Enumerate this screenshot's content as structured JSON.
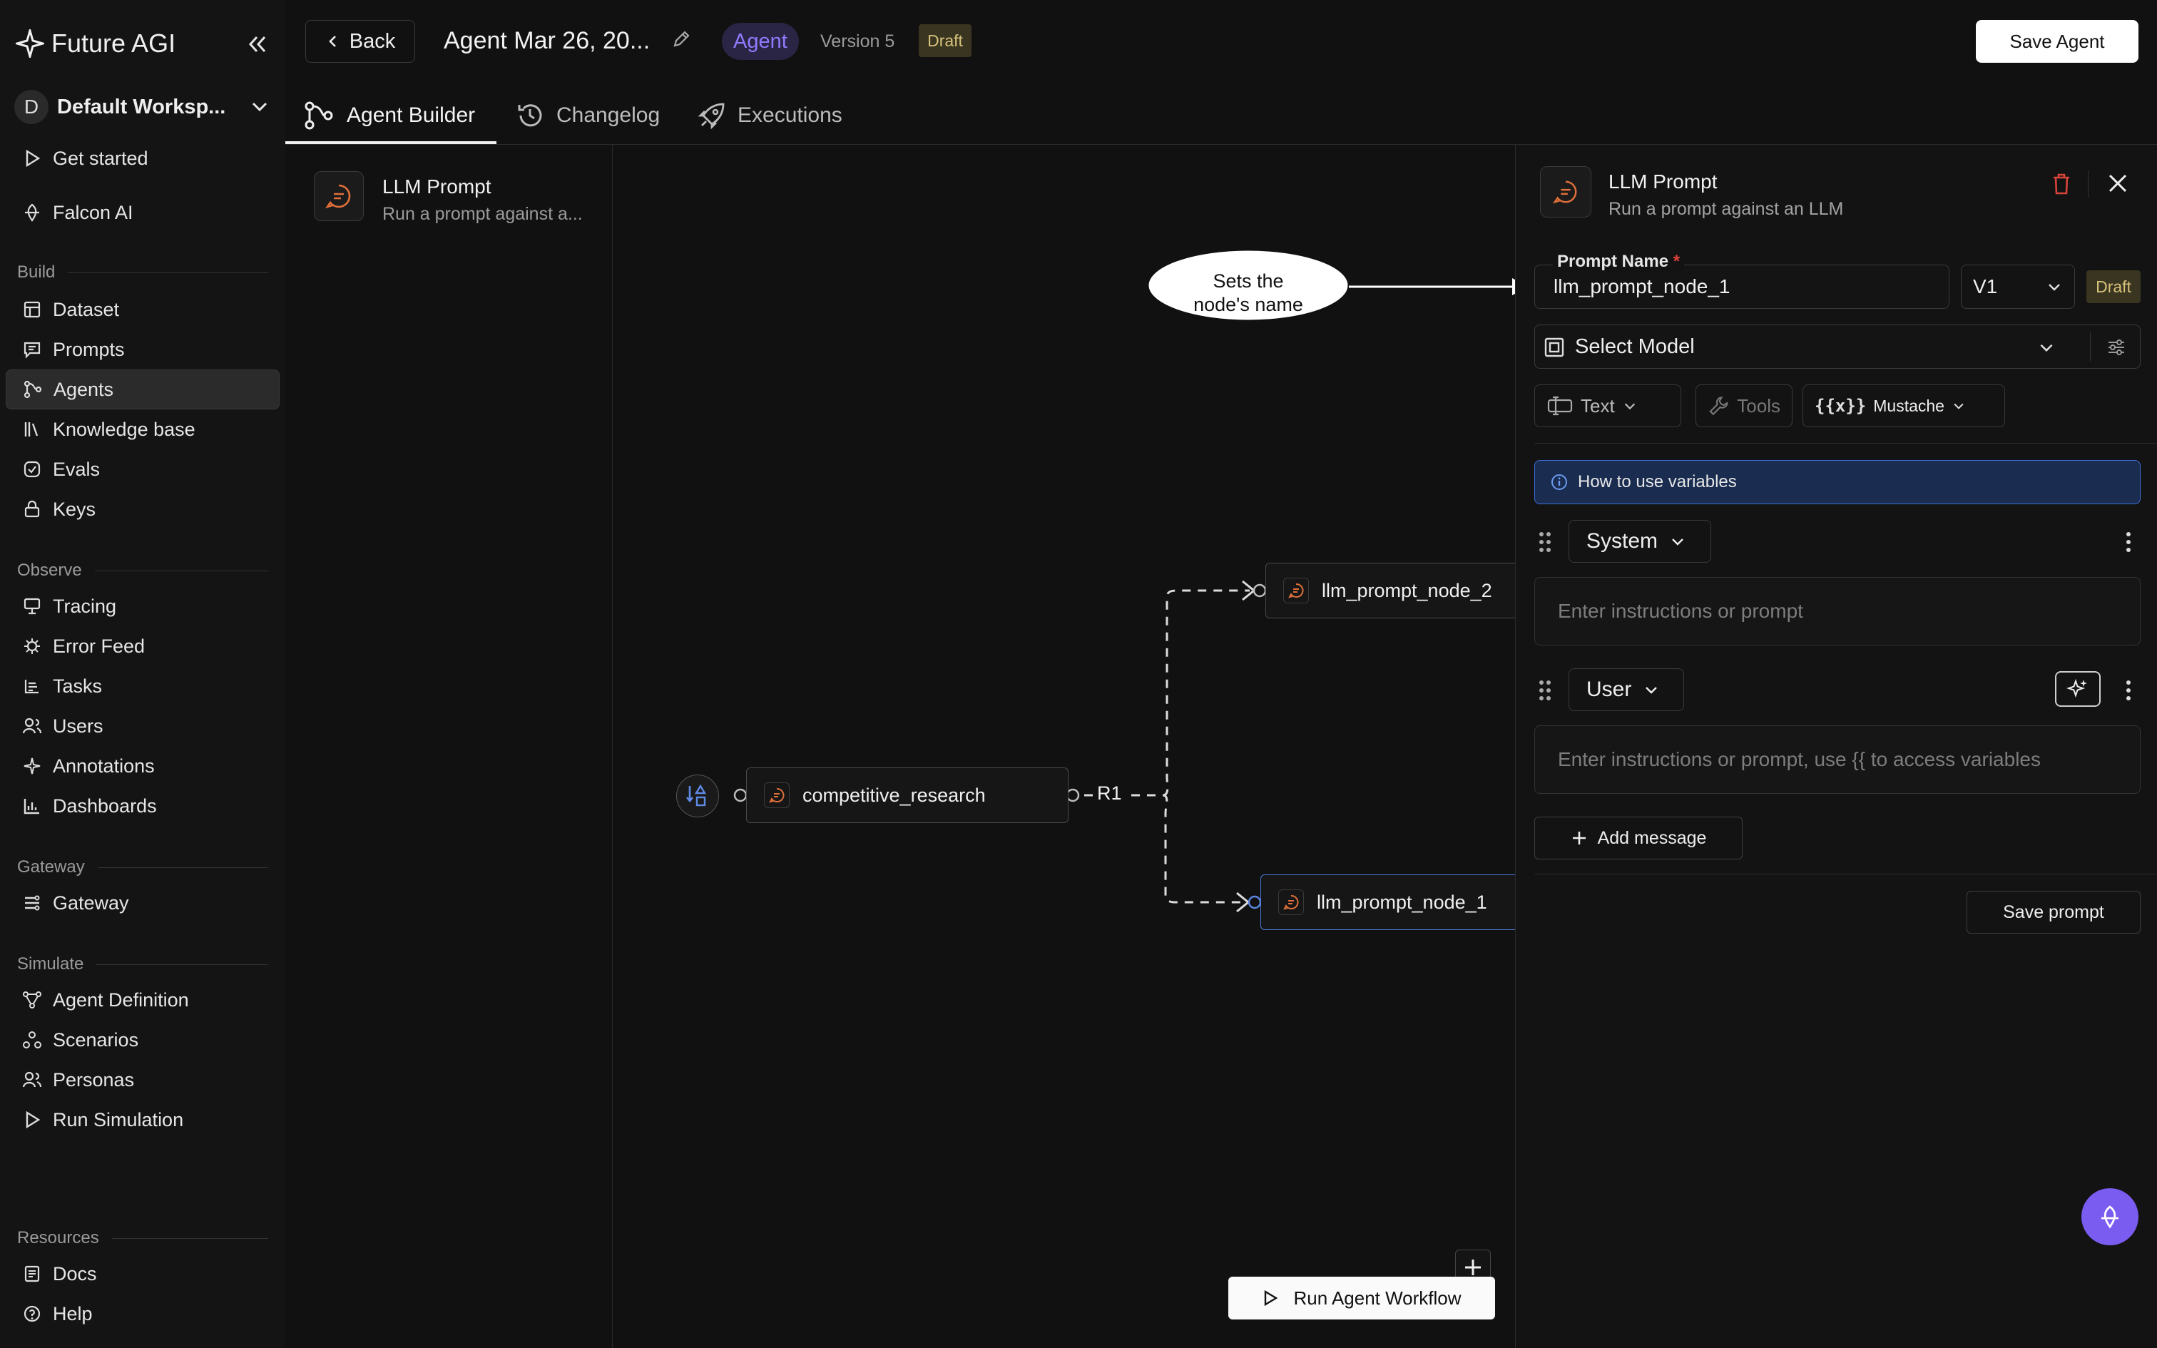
{
  "brand": {
    "name": "Future AGI"
  },
  "workspace": {
    "initial": "D",
    "name": "Default Worksp..."
  },
  "sidebar": {
    "top_items": [
      {
        "label": "Get started",
        "icon": "play-icon"
      },
      {
        "label": "Falcon AI",
        "icon": "falcon-icon"
      }
    ],
    "sections": {
      "build": "Build",
      "observe": "Observe",
      "gateway": "Gateway",
      "simulate": "Simulate",
      "resources": "Resources"
    },
    "build_items": [
      "Dataset",
      "Prompts",
      "Agents",
      "Knowledge base",
      "Evals",
      "Keys"
    ],
    "observe_items": [
      "Tracing",
      "Error Feed",
      "Tasks",
      "Users",
      "Annotations",
      "Dashboards"
    ],
    "gateway_items": [
      "Gateway"
    ],
    "simulate_items": [
      "Agent Definition",
      "Scenarios",
      "Personas",
      "Run Simulation"
    ],
    "resources_items": [
      "Docs",
      "Help"
    ],
    "active": "Agents"
  },
  "topbar": {
    "back_label": "Back",
    "agent_title": "Agent Mar 26, 20...",
    "agent_badge": "Agent",
    "version": "Version 5",
    "draft": "Draft",
    "save_label": "Save Agent"
  },
  "tabs": [
    "Agent Builder",
    "Changelog",
    "Executions"
  ],
  "library": {
    "title": "LLM Prompt",
    "subtitle": "Run a prompt against a..."
  },
  "canvas": {
    "nodes": {
      "source": "competitive_research",
      "top": "llm_prompt_node_2",
      "bottom": "llm_prompt_node_1"
    },
    "edge_label": "R1",
    "annotation": [
      "Sets the",
      "node's name"
    ],
    "run_label": "Run Agent Workflow"
  },
  "panel": {
    "title": "LLM Prompt",
    "subtitle": "Run a prompt against an LLM",
    "prompt_name_label": "Prompt Name",
    "prompt_name_value": "llm_prompt_node_1",
    "version": "V1",
    "draft": "Draft",
    "model_placeholder": "Select Model",
    "format_label": "Text",
    "tools_label": "Tools",
    "template_icon": "{{x}}",
    "template_label": "Mustache",
    "info_label": "How to use variables",
    "system_role": "System",
    "system_placeholder": "Enter instructions or prompt",
    "user_role": "User",
    "user_placeholder": "Enter instructions or prompt, use {{ to access variables",
    "add_message": "Add message",
    "save_prompt": "Save prompt"
  },
  "colors": {
    "background": "#111111",
    "accent_purple": "#7b5cf0",
    "info_blue": "#3b6fd6",
    "node_icon_orange": "#e0703a",
    "delete_red": "#d9443a"
  }
}
